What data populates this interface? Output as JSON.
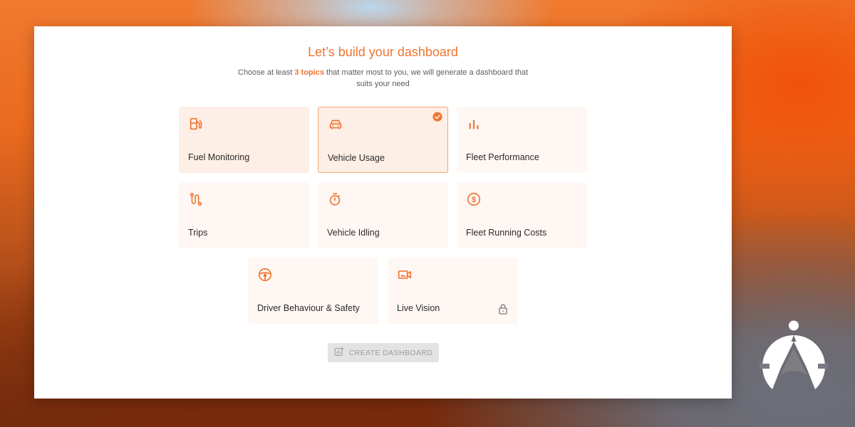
{
  "header": {
    "title": "Let’s build your dashboard",
    "subtitle_before": "Choose at least ",
    "subtitle_highlight": "3 topics",
    "subtitle_after": " that matter most to you, we will generate a dashboard that suits your need"
  },
  "topics": [
    {
      "label": "Fuel Monitoring",
      "icon": "fuel-pump-icon",
      "selected": false
    },
    {
      "label": "Vehicle Usage",
      "icon": "car-icon",
      "selected": true
    },
    {
      "label": "Fleet Performance",
      "icon": "bar-chart-icon",
      "selected": false
    },
    {
      "label": "Trips",
      "icon": "route-icon",
      "selected": false
    },
    {
      "label": "Vehicle Idling",
      "icon": "stopwatch-icon",
      "selected": false
    },
    {
      "label": "Fleet Running Costs",
      "icon": "dollar-circle-icon",
      "selected": false
    },
    {
      "label": "Driver Behaviour & Safety",
      "icon": "steering-wheel-icon",
      "selected": false
    },
    {
      "label": "Live Vision",
      "icon": "video-camera-icon",
      "selected": false,
      "locked": true
    }
  ],
  "actions": {
    "create_label": "CREATE DASHBOARD",
    "create_icon": "add-chart-icon"
  },
  "colors": {
    "accent": "#ee7532",
    "tile_bg": "#fff7f3",
    "tile_selected_bg": "#fdeee6",
    "tile_selected_border": "#f3a474",
    "button_disabled_bg": "#e3e3e3",
    "button_disabled_text": "#9c9c9c"
  },
  "brand": {
    "logo_icon": "brand-logo-icon"
  }
}
